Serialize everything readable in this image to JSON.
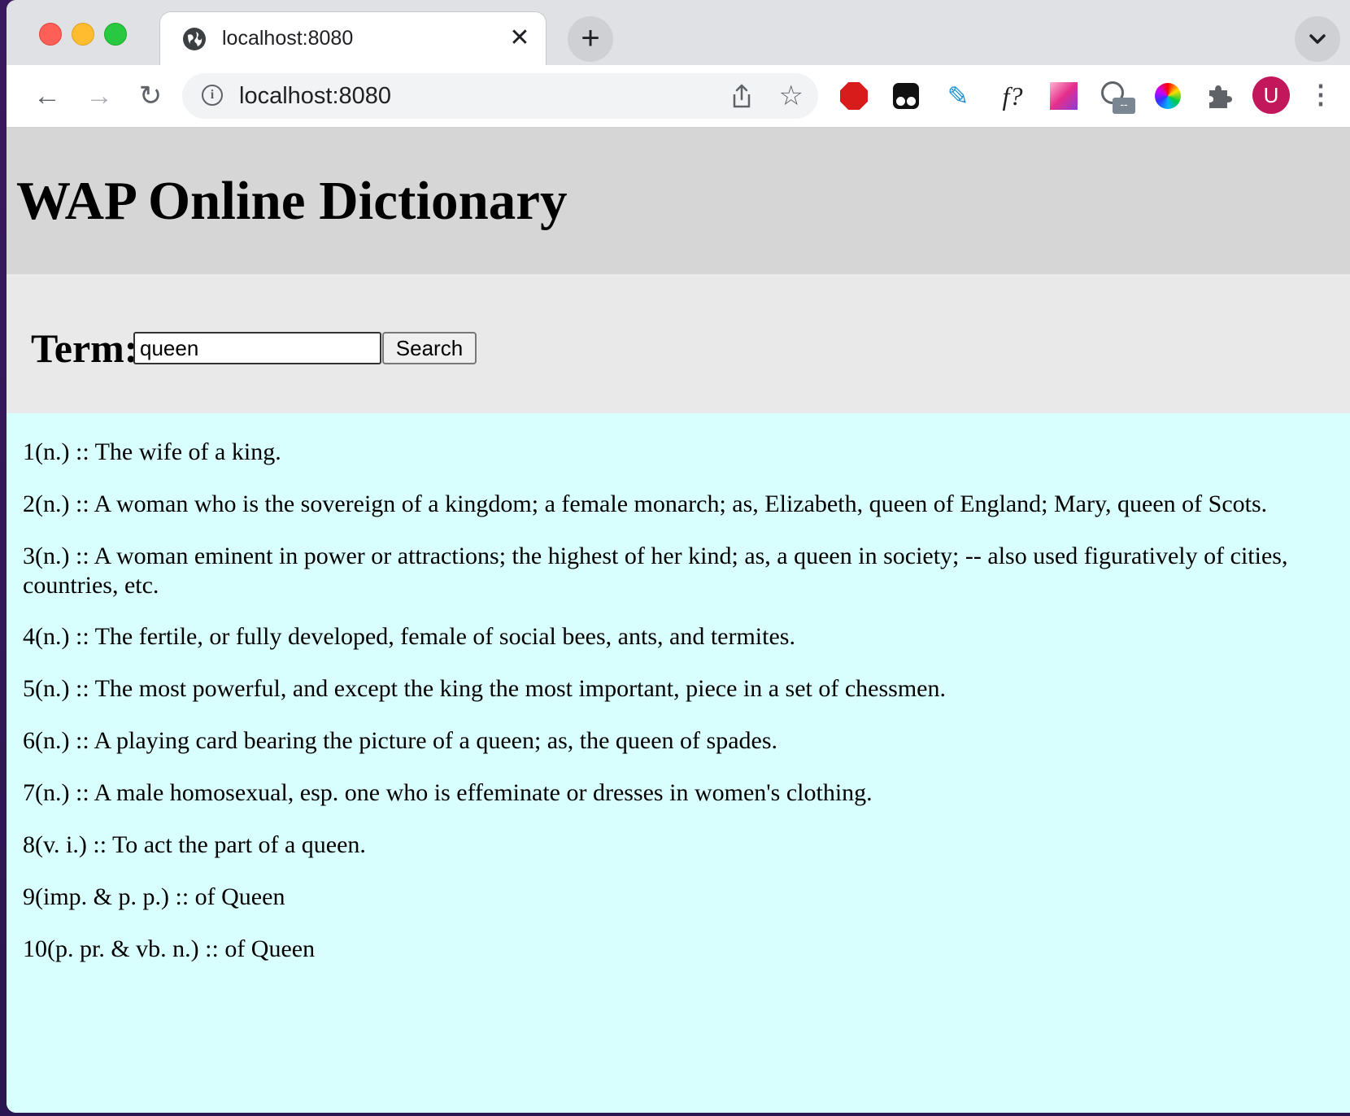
{
  "browser": {
    "tab_title": "localhost:8080",
    "url": "localhost:8080",
    "avatar_letter": "U",
    "extensions": [
      "stop-icon",
      "tampermonkey-icon",
      "highlighter-icon",
      "font-icon",
      "gradient-icon",
      "gauge-icon",
      "color-wheel-icon",
      "puzzle-icon"
    ],
    "font_ext_label": "f?",
    "gauge_badge": "--"
  },
  "page": {
    "title": "WAP Online Dictionary",
    "term_label": "Term:",
    "term_value": "queen",
    "search_label": "Search",
    "colors": {
      "header_bg": "#d6d6d6",
      "search_bg": "#e9e9e9",
      "results_bg": "#d9fefe"
    },
    "definitions": [
      "1(n.) :: The wife of a king.",
      "2(n.) :: A woman who is the sovereign of a kingdom; a female monarch; as, Elizabeth, queen of England; Mary, queen of Scots.",
      "3(n.) :: A woman eminent in power or attractions; the highest of her kind; as, a queen in society; -- also used figuratively of cities, countries, etc.",
      "4(n.) :: The fertile, or fully developed, female of social bees, ants, and termites.",
      "5(n.) :: The most powerful, and except the king the most important, piece in a set of chessmen.",
      "6(n.) :: A playing card bearing the picture of a queen; as, the queen of spades.",
      "7(n.) :: A male homosexual, esp. one who is effeminate or dresses in women's clothing.",
      "8(v. i.) :: To act the part of a queen.",
      "9(imp. & p. p.) :: of Queen",
      "10(p. pr. & vb. n.) :: of Queen"
    ]
  }
}
